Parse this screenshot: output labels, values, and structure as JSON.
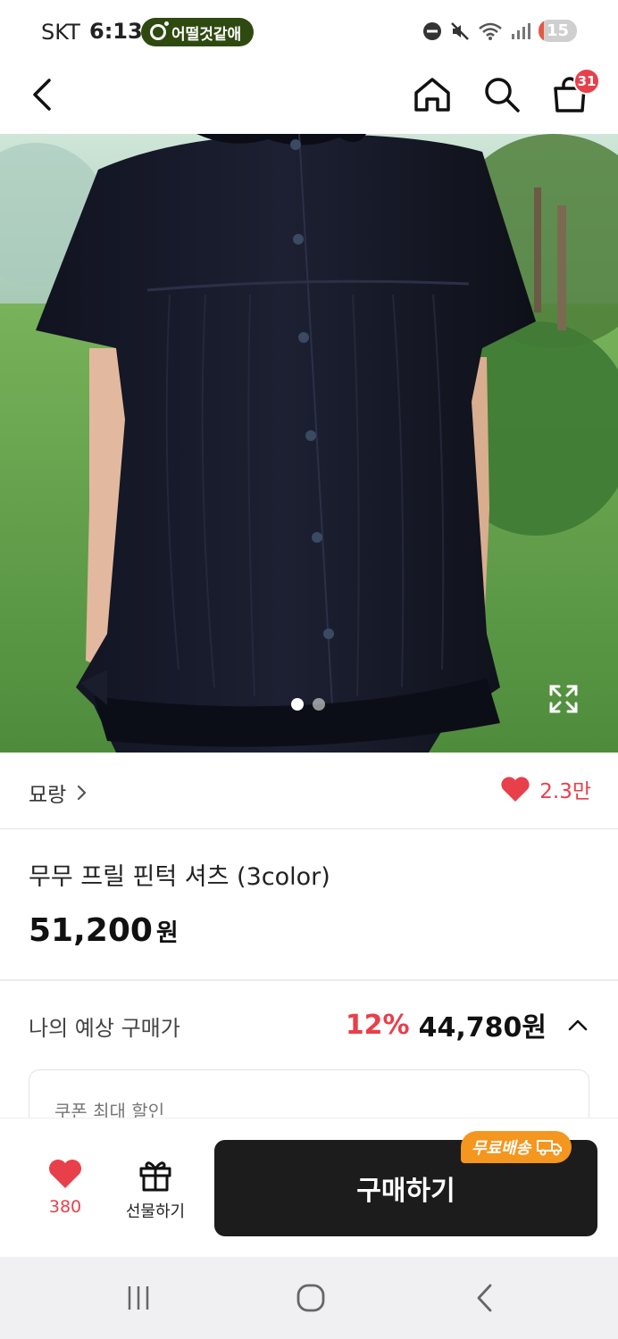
{
  "status_bar": {
    "carrier": "SKT",
    "time": "6:13",
    "app_pill": "어떨것같애",
    "battery": "15"
  },
  "header": {
    "cart_count": "31"
  },
  "gallery": {
    "total_images": 2,
    "current_index": 1
  },
  "seller": {
    "name": "묘랑",
    "likes": "2.3만"
  },
  "product": {
    "title": "무무 프릴 핀턱 셔츠 (3color)",
    "price": "51,200",
    "currency": "원"
  },
  "estimate": {
    "label": "나의 예상 구매가",
    "discount": "12%",
    "price": "44,780원"
  },
  "coupon": {
    "label": "쿠폰 최대 할인"
  },
  "action_bar": {
    "wish_count": "380",
    "gift_label": "선물하기",
    "buy_label": "구매하기",
    "free_shipping": "무료배송"
  },
  "colors": {
    "accent_red": "#e8404b",
    "badge_orange": "#f5961e",
    "buy_button": "#1c1c1c"
  }
}
